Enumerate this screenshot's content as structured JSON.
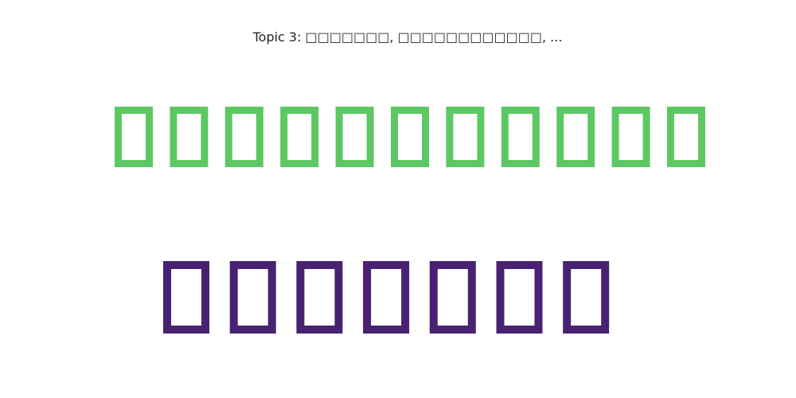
{
  "chart_data": {
    "type": "wordcloud",
    "title": "Topic 3: □□□□□□□, □□□□□□□□□□□□, ...",
    "words": [
      {
        "text": "□□□□□□□□□□□",
        "glyph_count": 11,
        "color": "#5dc863",
        "rank": 1
      },
      {
        "text": "□□□□□□□",
        "glyph_count": 7,
        "color": "#482173",
        "rank": 2
      }
    ]
  }
}
